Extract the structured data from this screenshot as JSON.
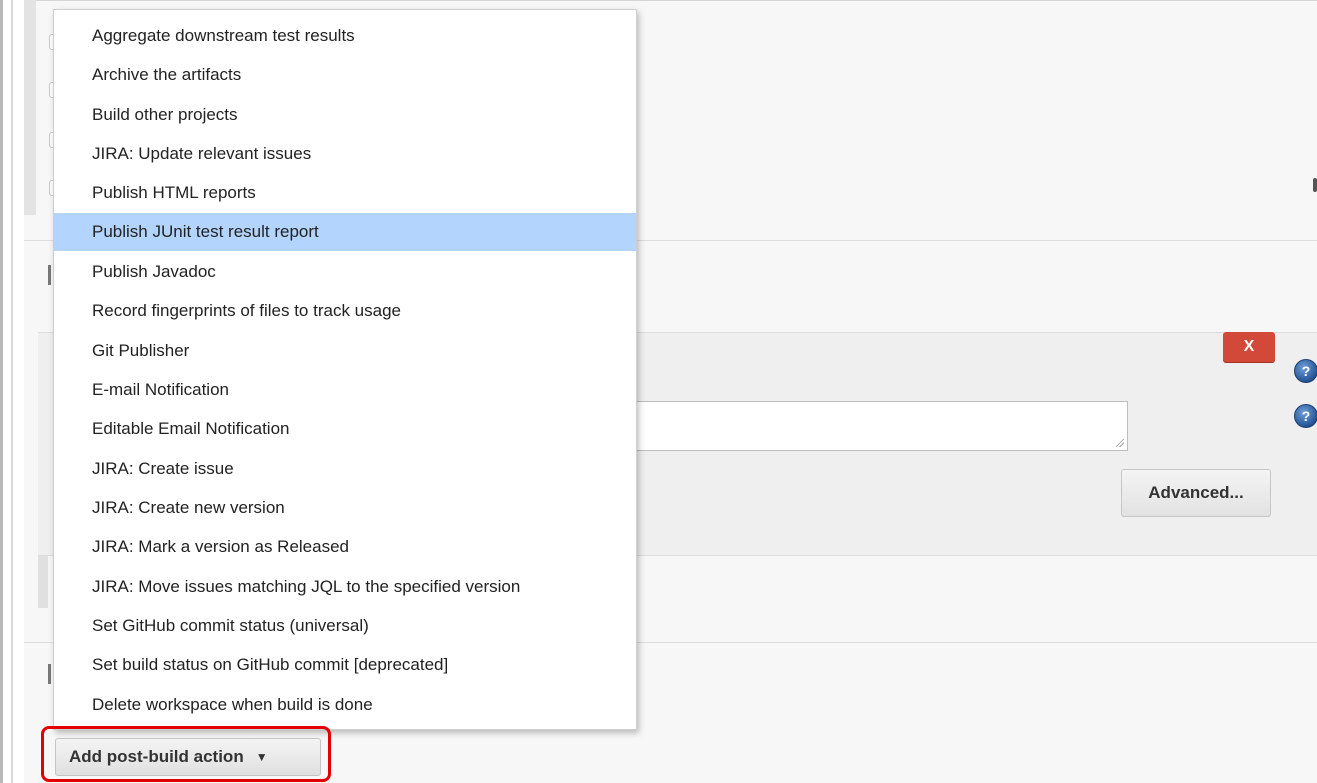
{
  "dropdown": {
    "items": [
      {
        "label": "Aggregate downstream test results",
        "selected": false
      },
      {
        "label": "Archive the artifacts",
        "selected": false
      },
      {
        "label": "Build other projects",
        "selected": false
      },
      {
        "label": "JIRA: Update relevant issues",
        "selected": false
      },
      {
        "label": "Publish HTML reports",
        "selected": false
      },
      {
        "label": "Publish JUnit test result report",
        "selected": true
      },
      {
        "label": "Publish Javadoc",
        "selected": false
      },
      {
        "label": "Record fingerprints of files to track usage",
        "selected": false
      },
      {
        "label": "Git Publisher",
        "selected": false
      },
      {
        "label": "E-mail Notification",
        "selected": false
      },
      {
        "label": "Editable Email Notification",
        "selected": false
      },
      {
        "label": "JIRA: Create issue",
        "selected": false
      },
      {
        "label": "JIRA: Create new version",
        "selected": false
      },
      {
        "label": "JIRA: Mark a version as Released",
        "selected": false
      },
      {
        "label": "JIRA: Move issues matching JQL to the specified version",
        "selected": false
      },
      {
        "label": "Set GitHub commit status (universal)",
        "selected": false
      },
      {
        "label": "Set build status on GitHub commit [deprecated]",
        "selected": false
      },
      {
        "label": "Delete workspace when build is done",
        "selected": false
      }
    ]
  },
  "junit_panel": {
    "delete_label": "X",
    "advanced_label": "Advanced...",
    "help_glyph": "?",
    "test_report_xmls_value": ""
  },
  "footer": {
    "add_action_label": "Add post-build action",
    "add_action_arrow": "▼"
  },
  "colors": {
    "selected_item_bg": "#b3d4fc",
    "delete_button": "#d24939",
    "highlight_frame": "#e30000"
  },
  "icons": [
    "help-icon",
    "resize-grip-icon",
    "dropdown-arrow-icon"
  ]
}
